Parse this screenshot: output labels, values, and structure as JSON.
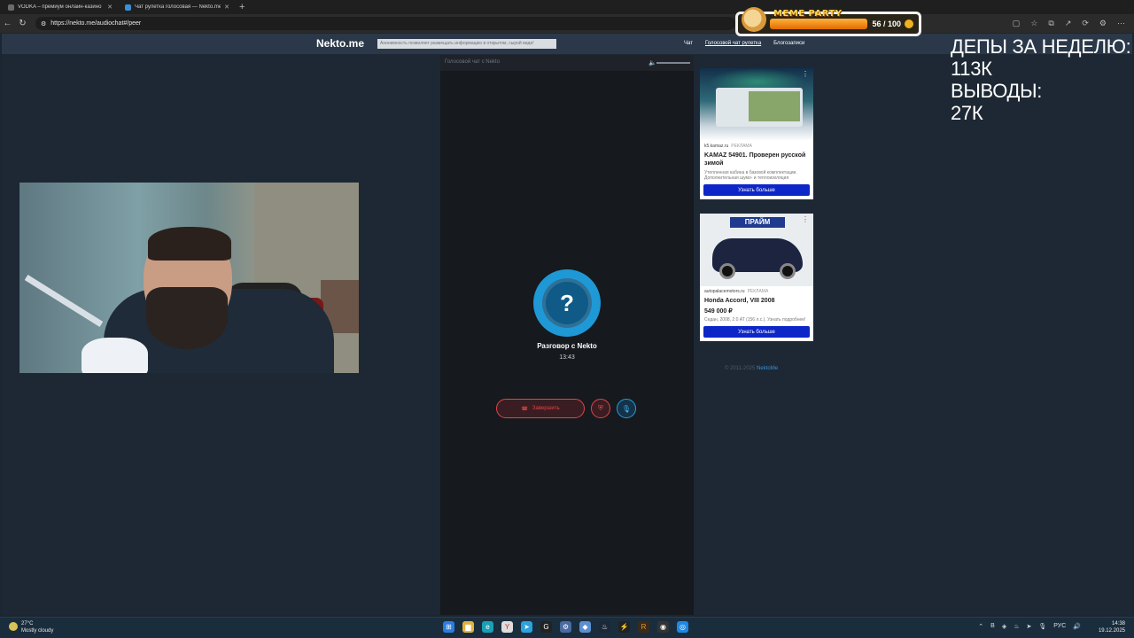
{
  "browser": {
    "tabs": [
      {
        "title": "VODKA – премиум онлайн-казино",
        "close": "✕"
      },
      {
        "title": "Чат рулетка голосовая — Nekto.me",
        "close": "✕"
      }
    ],
    "new_tab": "+",
    "url": "https://nekto.me/audiochat#/peer"
  },
  "stream_badge": {
    "title": "MEME PARTY",
    "score": "56 / 100"
  },
  "site": {
    "logo": "Nekto.me",
    "notice": "Анонимность позволяет размещать информацию в открытом, сырой виде!",
    "menu": [
      "Чат",
      "Голосовой чат рулетка",
      "Блогозаписи"
    ]
  },
  "call": {
    "header": "Голосовой чат с Nekto",
    "avatar_symbol": "?",
    "title": "Разговор с Nekto",
    "timer": "13:43",
    "end_label": "Завершить"
  },
  "ads": [
    {
      "source": "k5.kamaz.ru",
      "tag": "РЕКЛАМА",
      "headline": "KAMAZ 54901. Проверен русской зимой",
      "desc": "Утепленная кабина в базовой комплектации. Дополнительная шумо- и теплоизоляция",
      "button": "Узнать больше"
    },
    {
      "source": "autopalacemotors.ru",
      "tag": "РЕКЛАМА",
      "brand": "ПРАЙМ",
      "headline": "Honda Accord, VIII 2008",
      "price": "549 000 ₽",
      "desc": "Седан, 2008, 2.0 AT (156 л.с.). Узнать подробнее!",
      "button": "Узнать больше"
    }
  ],
  "footer": {
    "copyright": "© 2011-2025",
    "link": "NektoMe"
  },
  "overlay": {
    "line1": "ДЕПЫ ЗА НЕДЕЛЮ:",
    "line2": "113К",
    "line3": "ВЫВОДЫ:",
    "line4": "27К"
  },
  "taskbar": {
    "weather_temp": "27°C",
    "weather_desc": "Mostly cloudy",
    "lang": "РУС",
    "time": "14:38",
    "date": "19.12.2025"
  }
}
